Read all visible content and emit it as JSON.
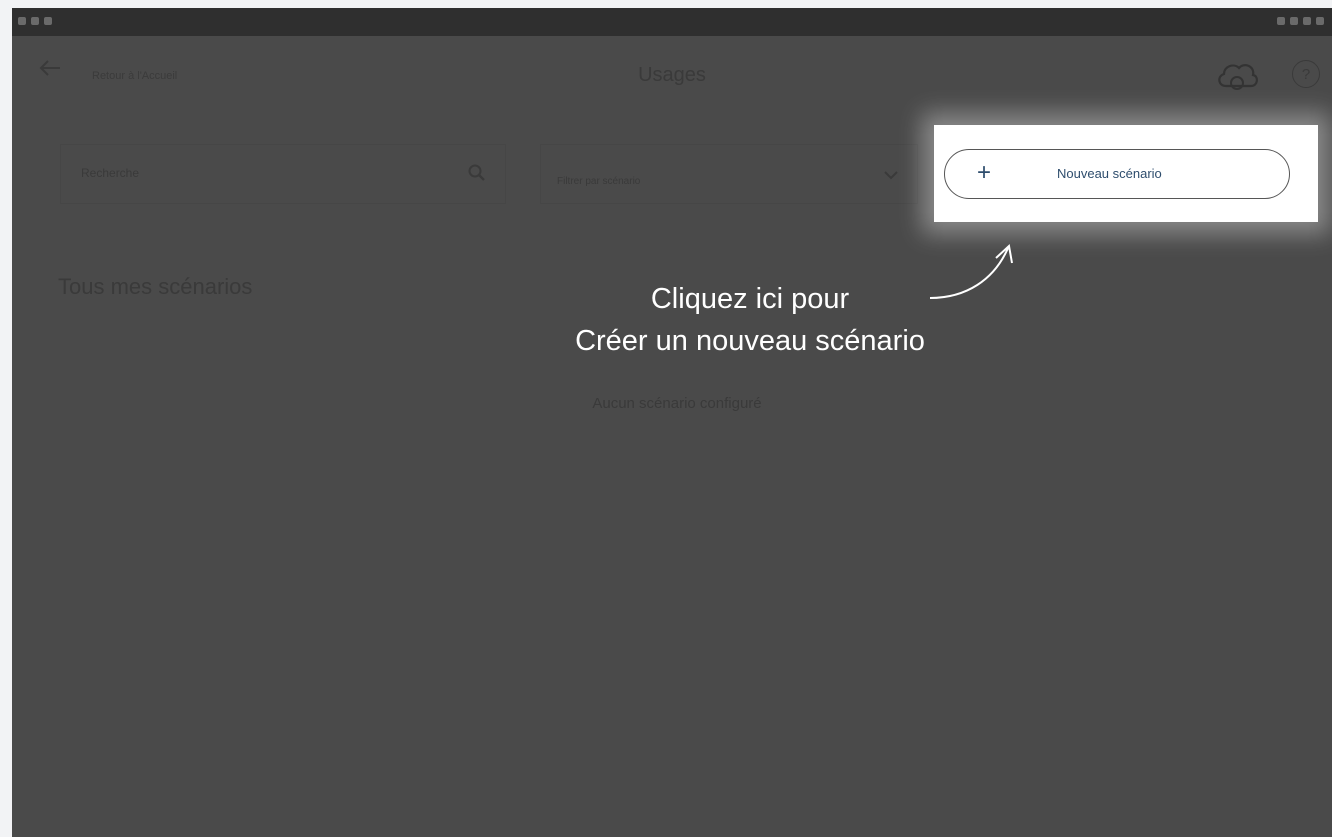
{
  "header": {
    "back_label": "Retour à l'Accueil",
    "title": "Usages"
  },
  "search": {
    "placeholder": "Recherche"
  },
  "filter": {
    "selected": "Filtrer par scénario"
  },
  "new_scenario_button": {
    "label": "Nouveau scénario"
  },
  "section": {
    "title": "Tous mes scénarios"
  },
  "callout": {
    "line1": "Cliquez ici pour",
    "line2": "Créer un nouveau scénario"
  },
  "empty_state": {
    "text": "Aucun scénario configuré"
  },
  "icons": {
    "back": "arrow-left-icon",
    "cloud": "cloud-sync-icon",
    "help": "help-icon",
    "search": "search-icon",
    "chevron": "chevron-down-icon",
    "plus": "plus-icon",
    "arrow": "curved-arrow-icon"
  },
  "colors": {
    "overlay": "#4a4a4a",
    "accent": "#2e4d6d",
    "callout_text": "#ffffff"
  }
}
